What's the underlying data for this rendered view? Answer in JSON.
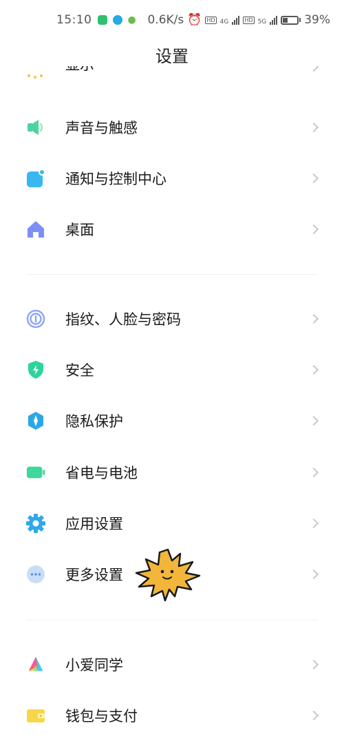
{
  "status_bar": {
    "time": "15:10",
    "net_speed": "0.6K/s",
    "hd1": "HD",
    "net1": "4G",
    "hd2": "HD",
    "net2": "5G",
    "battery": "39%"
  },
  "header": {
    "title": "设置"
  },
  "partial_item": {
    "label": "显示"
  },
  "groups": [
    {
      "items": [
        {
          "label": "声音与触感",
          "icon": "speaker-icon"
        },
        {
          "label": "通知与控制中心",
          "icon": "notification-icon"
        },
        {
          "label": "桌面",
          "icon": "home-icon"
        }
      ]
    },
    {
      "items": [
        {
          "label": "指纹、人脸与密码",
          "icon": "fingerprint-icon"
        },
        {
          "label": "安全",
          "icon": "shield-icon"
        },
        {
          "label": "隐私保护",
          "icon": "privacy-icon"
        },
        {
          "label": "省电与电池",
          "icon": "battery-icon"
        },
        {
          "label": "应用设置",
          "icon": "gear-icon"
        },
        {
          "label": "更多设置",
          "icon": "more-icon"
        }
      ]
    },
    {
      "items": [
        {
          "label": "小爱同学",
          "icon": "xiaoai-icon"
        },
        {
          "label": "钱包与支付",
          "icon": "wallet-icon"
        }
      ]
    }
  ],
  "colors": {
    "speaker": "#4cd3a0",
    "notification": "#3ab7f0",
    "home": "#7b8ff7",
    "fingerprint": "#8fa6f5",
    "shield": "#2fd39a",
    "privacy": "#2ba7e6",
    "battery": "#3fd79a",
    "gear": "#2fa9e8",
    "more": "#c8def8",
    "wallet": "#f7d64a"
  }
}
